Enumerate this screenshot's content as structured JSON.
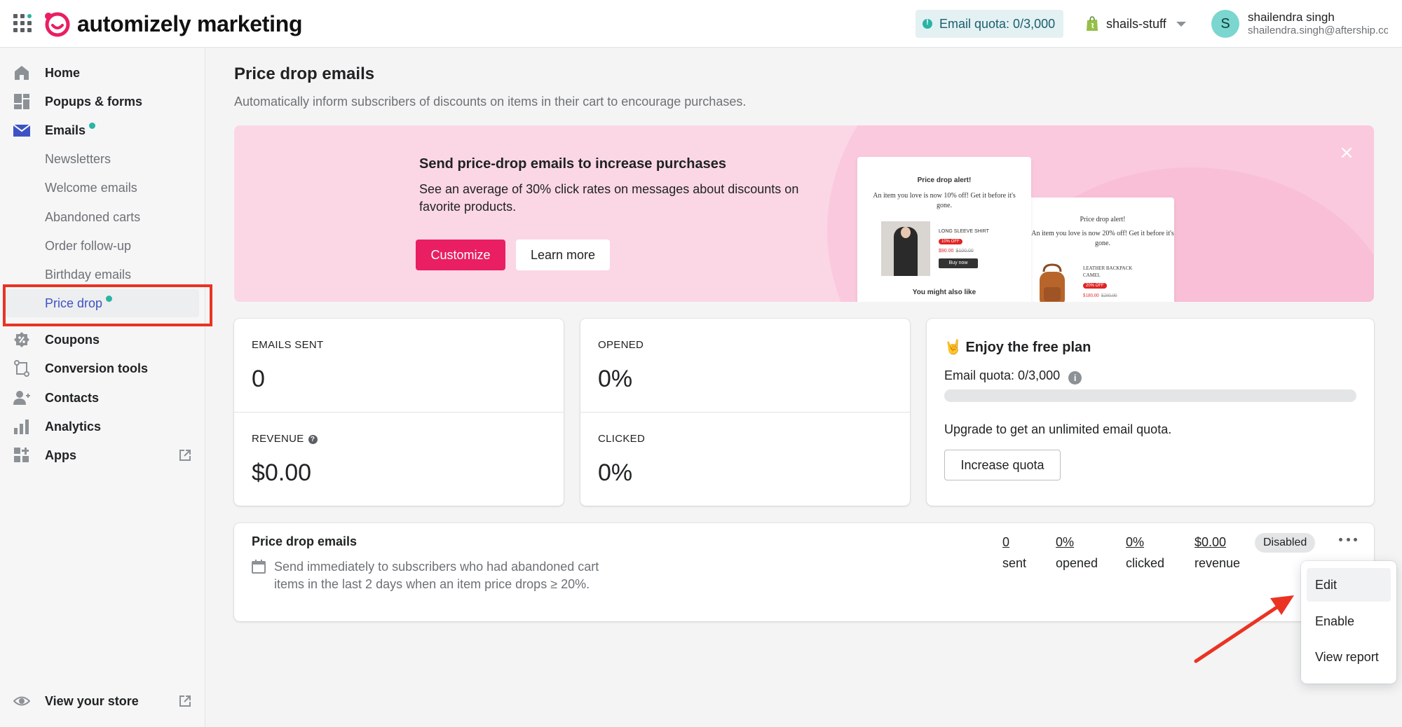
{
  "header": {
    "brand": "automizely marketing",
    "quota_label": "Email quota: 0/3,000",
    "store_name": "shails-stuff",
    "user_initial": "S",
    "user_name": "shailendra singh",
    "user_email": "shailendra.singh@aftership.com"
  },
  "sidebar": {
    "items": [
      {
        "label": "Home",
        "icon": "home-icon"
      },
      {
        "label": "Popups & forms",
        "icon": "popups-icon"
      },
      {
        "label": "Emails",
        "icon": "mail-icon"
      },
      {
        "label": "Coupons",
        "icon": "coupon-icon"
      },
      {
        "label": "Conversion tools",
        "icon": "conversion-icon"
      },
      {
        "label": "Contacts",
        "icon": "contacts-icon"
      },
      {
        "label": "Analytics",
        "icon": "analytics-icon"
      },
      {
        "label": "Apps",
        "icon": "apps-icon"
      }
    ],
    "email_subitems": [
      "Newsletters",
      "Welcome emails",
      "Abandoned carts",
      "Order follow-up",
      "Birthday emails",
      "Price drop"
    ],
    "footer_label": "View your store"
  },
  "page": {
    "title": "Price drop emails",
    "subtitle": "Automatically inform subscribers of discounts on items in their cart to encourage purchases."
  },
  "banner": {
    "title": "Send price-drop emails to increase purchases",
    "text": "See an average of 30% click rates on messages about discounts on favorite products.",
    "primary_label": "Customize",
    "secondary_label": "Learn more",
    "mock1": {
      "title": "Price drop alert!",
      "text": "An item you love is now 10% off! Get it before it's gone.",
      "product": "LONG SLEEVE SHIRT",
      "tag": "10% OFF",
      "price": "$90.00",
      "old_price": "$100.00",
      "buy": "Buy now",
      "footer": "You might also like"
    },
    "mock2": {
      "title": "Price drop alert!",
      "text": "An item you love is now 20% off! Get it before it's gone.",
      "product": "LEATHER BACKPACK CAMEL",
      "tag": "20% OFF",
      "price": "$180.00",
      "old_price": "$200.00"
    }
  },
  "stats": {
    "emails_sent_label": "EMAILS SENT",
    "emails_sent": "0",
    "revenue_label": "REVENUE",
    "revenue": "$0.00",
    "opened_label": "OPENED",
    "opened": "0%",
    "clicked_label": "CLICKED",
    "clicked": "0%"
  },
  "plan": {
    "emoji": "🤘",
    "title": "Enjoy the free plan",
    "quota_label": "Email quota: 0/3,000",
    "quota_used_fraction": 0,
    "upgrade_text": "Upgrade to get an unlimited email quota.",
    "button_label": "Increase quota"
  },
  "flow": {
    "title": "Price drop emails",
    "description": "Send immediately to subscribers who had abandoned cart items in the last 2 days when an item price drops ≥ 20%.",
    "metrics": [
      {
        "value": "0",
        "label": "sent"
      },
      {
        "value": "0%",
        "label": "opened"
      },
      {
        "value": "0%",
        "label": "clicked"
      },
      {
        "value": "$0.00",
        "label": "revenue"
      }
    ],
    "status": "Disabled"
  },
  "dropdown": {
    "items": [
      "Edit",
      "Enable",
      "View report"
    ]
  },
  "colors": {
    "accent": "#2ab4a5",
    "primary_button": "#e91e63",
    "active_link": "#3d53c4",
    "annotation": "#ea3323"
  }
}
